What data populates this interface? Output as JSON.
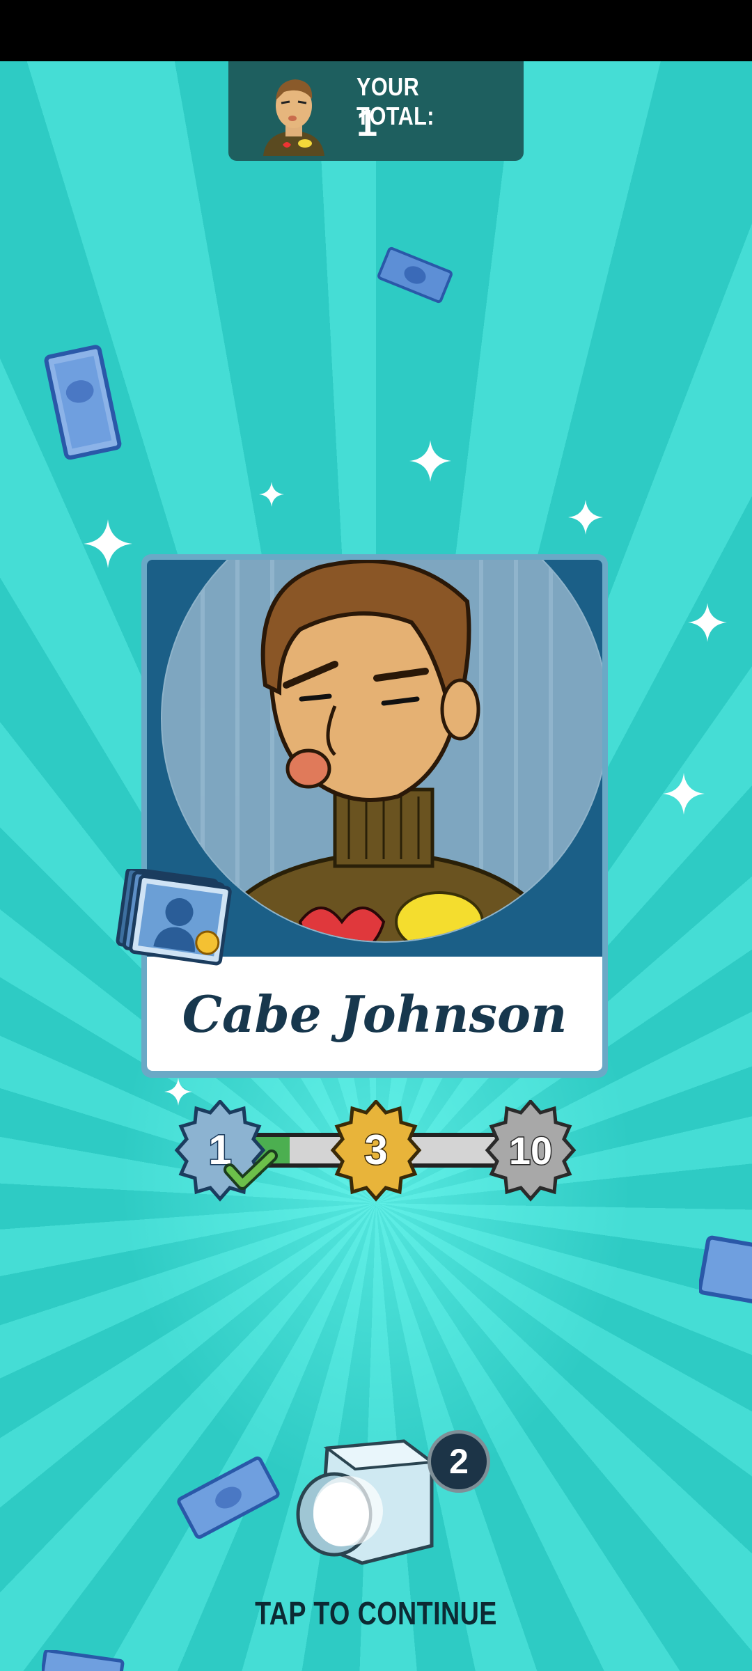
{
  "header": {
    "total_label": "YOUR TOTAL:",
    "total_value": "1"
  },
  "card": {
    "name": "Cabe Johnson",
    "background_color": "#1b5f87"
  },
  "progress": {
    "milestones": [
      "1",
      "3",
      "10"
    ],
    "achieved": "1"
  },
  "chest": {
    "count": "2"
  },
  "footer": {
    "tap_label": "TAP TO CONTINUE"
  },
  "icons": [
    "check-icon",
    "card-collection-icon",
    "sparkle-icon",
    "money-bill-icon",
    "chest-icon"
  ]
}
